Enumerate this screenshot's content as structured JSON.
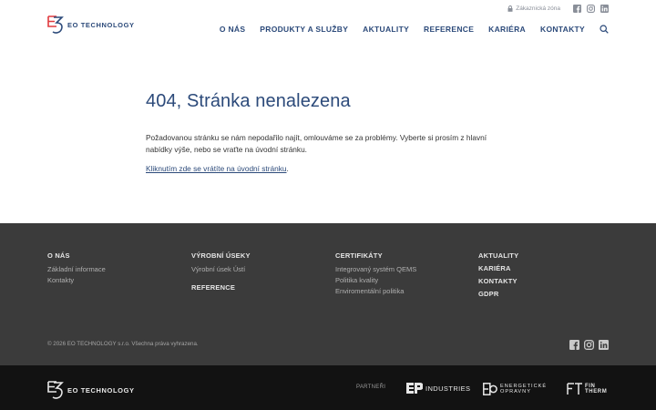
{
  "brand": {
    "name": "EO TECHNOLOGY",
    "color": "#2c4a7a",
    "accent": "#e03a3e"
  },
  "header": {
    "customer_zone": "Zákaznická zóna",
    "nav": [
      "O NÁS",
      "PRODUKTY A SLUŽBY",
      "AKTUALITY",
      "REFERENCE",
      "KARIÉRA",
      "KONTAKTY"
    ],
    "icons": [
      "lock-icon",
      "facebook-icon",
      "instagram-icon",
      "linkedin-icon",
      "search-icon"
    ]
  },
  "main": {
    "title": "404, Stránka nenalezena",
    "paragraph": "Požadovanou stránku se nám nepodařilo najít, omlouváme se za problémy. Vyberte si prosím z hlavní nabídky výše, nebo se vraťte na úvodní stránku.",
    "link": "Kliknutím zde se vrátíte na úvodní stránku",
    "link_suffix": "."
  },
  "footer": {
    "col1": {
      "heading": "O NÁS",
      "links": [
        "Základní informace",
        "Kontakty"
      ]
    },
    "col2": {
      "heading": "VÝROBNÍ ÚSEKY",
      "links": [
        "Výrobní úsek Ústí"
      ],
      "heading2": "REFERENCE"
    },
    "col3": {
      "heading": "CERTIFIKÁTY",
      "links": [
        "Integrovaný systém QEMS",
        "Politika kvality",
        "Enviromentální politika"
      ]
    },
    "col4": {
      "headings": [
        "AKTUALITY",
        "KARIÉRA",
        "KONTAKTY",
        "GDPR"
      ]
    },
    "copyright": "© 2026 EO TECHNOLOGY s.r.o. Všechna práva vyhrazena."
  },
  "bottom": {
    "brand": "EO TECHNOLOGY",
    "partners_label": "PARTNEŘI",
    "partners": {
      "industries": "INDUSTRIES",
      "eo_line1": "ENERGETICKÉ",
      "eo_line2": "OPRAVNY",
      "fin_line1": "FIN",
      "fin_line2": "THERM"
    }
  }
}
